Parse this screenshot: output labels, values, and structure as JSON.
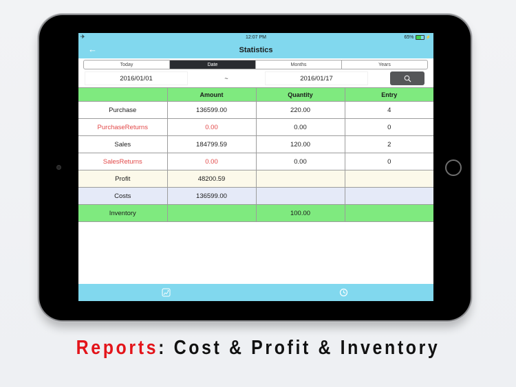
{
  "status_bar": {
    "left_icon": "airplane-icon",
    "time": "12:07 PM",
    "battery": "65%"
  },
  "nav": {
    "back_icon": "arrow-left-icon",
    "title": "Statistics"
  },
  "segments": [
    {
      "label": "Today",
      "active": false
    },
    {
      "label": "Date",
      "active": true
    },
    {
      "label": "Months",
      "active": false
    },
    {
      "label": "Years",
      "active": false
    }
  ],
  "date_range": {
    "start": "2016/01/01",
    "separator": "~",
    "end": "2016/01/17",
    "search_icon": "search-icon"
  },
  "table": {
    "columns": [
      "",
      "Amount",
      "Quantity",
      "Entry"
    ],
    "rows": [
      {
        "label": "Purchase",
        "amount": "136599.00",
        "quantity": "220.00",
        "entry": "4"
      },
      {
        "label": "PurchaseReturns",
        "amount": "0.00",
        "quantity": "0.00",
        "entry": "0"
      },
      {
        "label": "Sales",
        "amount": "184799.59",
        "quantity": "120.00",
        "entry": "2"
      },
      {
        "label": "SalesReturns",
        "amount": "0.00",
        "quantity": "0.00",
        "entry": "0"
      },
      {
        "label": "Profit",
        "amount": "48200.59",
        "quantity": "",
        "entry": ""
      },
      {
        "label": "Costs",
        "amount": "136599.00",
        "quantity": "",
        "entry": ""
      },
      {
        "label": "Inventory",
        "amount": "",
        "quantity": "100.00",
        "entry": ""
      }
    ]
  },
  "tab_bar": {
    "items": [
      {
        "icon": "chart-icon"
      },
      {
        "icon": "clock-icon"
      }
    ]
  },
  "caption": {
    "highlight": "Reports",
    "rest": ": Cost & Profit & Inventory"
  },
  "colors": {
    "header_bg": "#81d8ee",
    "table_header_bg": "#7fea7f",
    "return_text": "#e24848",
    "caption_accent": "#e3141a"
  }
}
